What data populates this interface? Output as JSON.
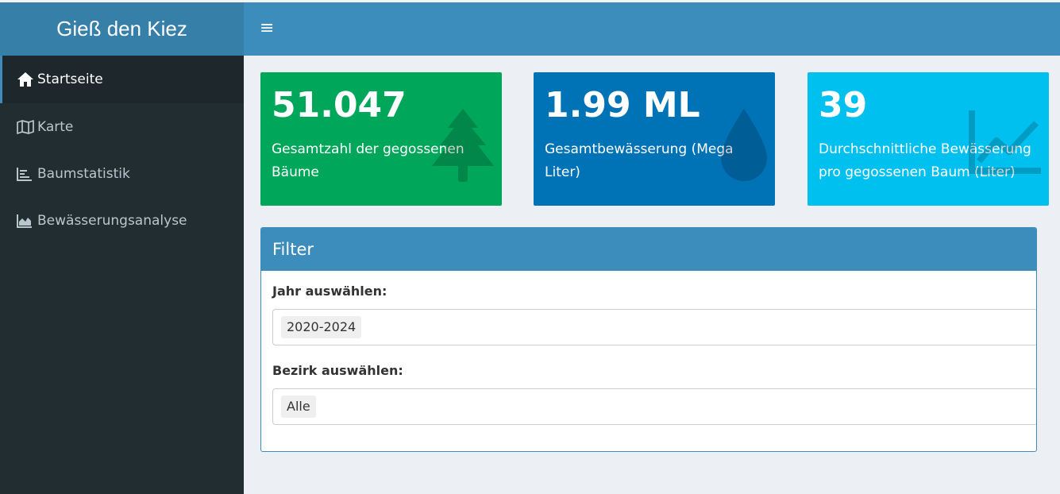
{
  "app": {
    "title": "Gieß den Kiez"
  },
  "header": {
    "menu_toggle_icon": "bars-icon"
  },
  "sidebar": {
    "items": [
      {
        "label": "Startseite",
        "icon": "home-icon",
        "active": true
      },
      {
        "label": "Karte",
        "icon": "map-icon",
        "active": false
      },
      {
        "label": "Baumstatistik",
        "icon": "bar-chart-icon",
        "active": false
      },
      {
        "label": "Bewässerungsanalyse",
        "icon": "area-chart-icon",
        "active": false
      }
    ]
  },
  "value_boxes": [
    {
      "value": "51.047",
      "label": "Gesamtzahl der gegossenen Bäume",
      "icon": "tree-icon",
      "color": "#00a65a"
    },
    {
      "value": "1.99 ML",
      "label": "Gesamtbewässerung (Mega Liter)",
      "icon": "tint-icon",
      "color": "#0073b7"
    },
    {
      "value": "39",
      "label": "Durchschnittliche Bewässerung pro gegossenen Baum (Liter)",
      "icon": "line-chart-icon",
      "color": "#00c0ef"
    }
  ],
  "filter": {
    "title": "Filter",
    "year": {
      "label": "Jahr auswählen:",
      "selected": "2020-2024"
    },
    "district": {
      "label": "Bezirk auswählen:",
      "selected": "Alle"
    }
  },
  "colors": {
    "primary": "#3c8dbc",
    "sidebar": "#222d32",
    "logo": "#367fa9",
    "background": "#ecf0f5"
  }
}
